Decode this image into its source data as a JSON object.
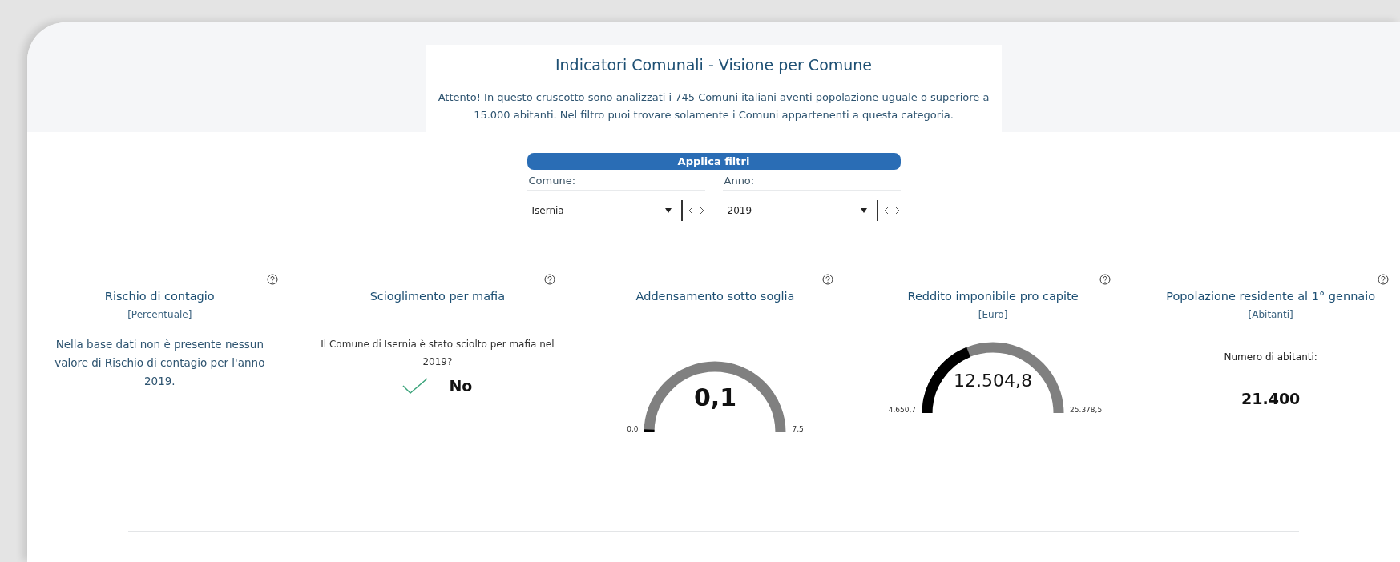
{
  "header": {
    "title": "Indicatori Comunali - Visione per Comune",
    "notice": "Attento! In questo cruscotto sono analizzati i 745 Comuni italiani aventi popolazione uguale o superiore a 15.000 abitanti. Nel filtro puoi trovare solamente i Comuni appartenenti a questa categoria."
  },
  "filters": {
    "title": "Applica filtri",
    "fields": [
      {
        "label": "Comune:",
        "value": "Isernia"
      },
      {
        "label": "Anno:",
        "value": "2019"
      }
    ]
  },
  "cards": [
    {
      "kind": "text",
      "title": "Rischio di contagio",
      "unit": "[Percentuale]",
      "message": "Nella base dati non è presente nessun valore di Rischio di contagio per l'anno 2019."
    },
    {
      "kind": "answer",
      "title": "Scioglimento per mafia",
      "question": "Il Comune di Isernia è stato sciolto per mafia nel 2019?",
      "answer": "No"
    },
    {
      "kind": "gauge",
      "title": "Addensamento sotto soglia",
      "value": "0,1",
      "min": "0,0",
      "max": "7,5"
    },
    {
      "kind": "gauge",
      "title": "Reddito imponibile pro capite",
      "unit": "[Euro]",
      "value": "12.504,8",
      "min": "4.650,7",
      "max": "25.378,5"
    },
    {
      "kind": "number",
      "title": "Popolazione residente al 1° gennaio",
      "unit": "[Abitanti]",
      "caption": "Numero di abitanti:",
      "value": "21.400"
    }
  ]
}
